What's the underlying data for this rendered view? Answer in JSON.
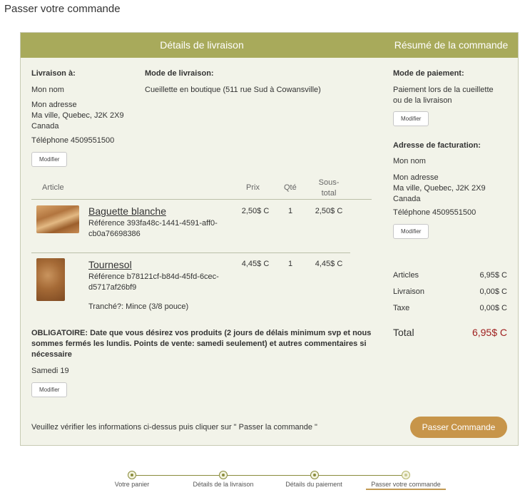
{
  "page_title": "Passer votre commande",
  "header": {
    "left_title": "Détails de livraison",
    "right_title": "Résumé de la commande"
  },
  "delivery": {
    "to_label": "Livraison à:",
    "name": "Mon nom",
    "address_line1": "Mon adresse",
    "address_line2": "Ma ville, Quebec, J2K 2X9",
    "country": "Canada",
    "phone": "Téléphone 4509551500",
    "modify_label": "Modifier",
    "mode_label": "Mode de livraison:",
    "mode_value": "Cueillette en boutique (511 rue Sud à Cowansville)"
  },
  "table": {
    "headers": {
      "article": "Article",
      "price": "Prix",
      "qty": "Qté",
      "subtotal_1": "Sous-",
      "subtotal_2": "total"
    },
    "items": [
      {
        "name": "Baguette blanche",
        "ref_line1": "Référence 393fa48c-1441-4591-aff0-",
        "ref_line2": "cb0a76698386",
        "price": "2,50$ C",
        "qty": "1",
        "subtotal": "2,50$ C"
      },
      {
        "name": "Tournesol",
        "ref_line1": "Référence b78121cf-b84d-45fd-6cec-",
        "ref_line2": "d5717af26bf9",
        "option": "Tranché?: Mince (3/8 pouce)",
        "price": "4,45$ C",
        "qty": "1",
        "subtotal": "4,45$ C"
      }
    ]
  },
  "notes": {
    "line1": "OBLIGATOIRE: Date que vous désirez vos produits (2 jours de délais minimum svp et nous",
    "line2": "sommes fermés les lundis. Points de vente: samedi seulement) et autres commentaires si",
    "line3": "nécessaire",
    "value": "Samedi 19",
    "modify_label": "Modifier"
  },
  "payment": {
    "mode_label": "Mode de paiement:",
    "mode_line1": "Paiement lors de la cueillette",
    "mode_line2": "ou de la livraison",
    "modify_label": "Modifier",
    "billing_label": "Adresse de facturation:",
    "name": "Mon nom",
    "address_line1": "Mon adresse",
    "address_line2": "Ma ville, Quebec, J2K 2X9",
    "country": "Canada",
    "phone": "Téléphone 4509551500",
    "billing_modify_label": "Modifier"
  },
  "summary": {
    "articles_label": "Articles",
    "articles_value": "6,95$ C",
    "delivery_label": "Livraison",
    "delivery_value": "0,00$ C",
    "tax_label": "Taxe",
    "tax_value": "0,00$ C",
    "total_label": "Total",
    "total_value": "6,95$ C"
  },
  "footer": {
    "instruction": "Veuillez vérifier les informations ci-dessus puis cliquer sur \" Passer la commande \"",
    "submit_label": "Passer Commande"
  },
  "steps": [
    {
      "label": "Votre panier"
    },
    {
      "label": "Détails de la livraison"
    },
    {
      "label": "Détails du paiement"
    },
    {
      "label": "Passer votre commande",
      "current": true
    }
  ],
  "colors": {
    "header_bg": "#a8aa5b",
    "panel_bg": "#f2f3e9",
    "accent_button": "#c7954a",
    "total_color": "#9e1c1c"
  }
}
